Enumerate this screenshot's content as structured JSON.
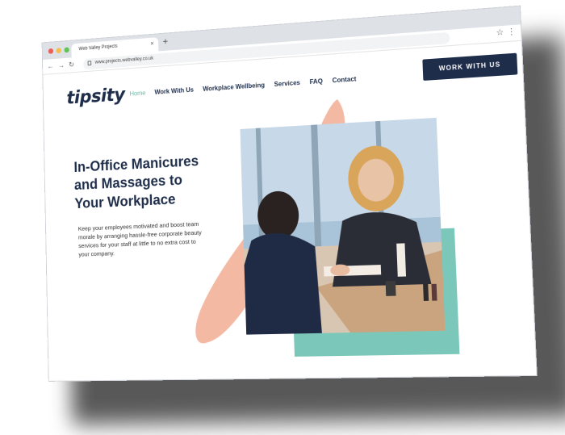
{
  "browser": {
    "tab_title": "Web Valley Projects",
    "tab_close": "×",
    "new_tab": "+",
    "url": "www.projects.webvalley.co.uk",
    "back": "←",
    "forward": "→",
    "reload": "↻",
    "star": "☆",
    "menu": "⋮"
  },
  "site": {
    "logo": "tipsity",
    "nav": [
      {
        "label": "Home",
        "active": true
      },
      {
        "label": "Work With Us"
      },
      {
        "label": "Workplace Wellbeing"
      },
      {
        "label": "Services"
      },
      {
        "label": "FAQ"
      },
      {
        "label": "Contact"
      }
    ],
    "cta": "WORK WITH US"
  },
  "hero": {
    "headline_line1": "In-Office Manicures",
    "headline_line2": "and Massages to",
    "headline_line3": "Your Workplace",
    "subtext": "Keep your employees motivated and boost team morale by arranging hassle-free corporate beauty services for your staff at little to no extra cost to your company."
  },
  "colors": {
    "navy": "#1e2d4a",
    "teal": "#7bc8bb",
    "peach": "#f4b9a3",
    "active_link": "#5bbfa8"
  }
}
